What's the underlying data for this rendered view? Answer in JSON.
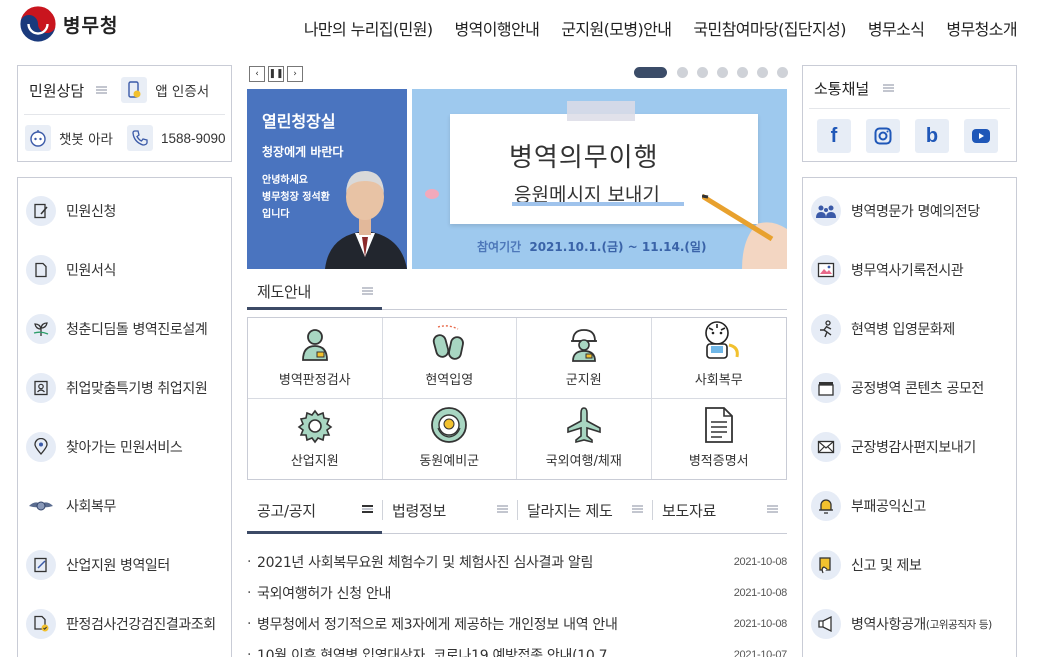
{
  "header": {
    "logo_text": "병무청",
    "nav": [
      "나만의 누리집(민원)",
      "병역이행안내",
      "군지원(모병)안내",
      "국민참여마당(집단지성)",
      "병무소식",
      "병무청소개"
    ]
  },
  "left_top": {
    "title": "민원상담",
    "app_auth": "앱 인증서",
    "chatbot": "챗봇 아라",
    "phone": "1588-9090"
  },
  "left_menu": [
    {
      "label": "민원신청",
      "icon": "pen-doc-icon"
    },
    {
      "label": "민원서식",
      "icon": "doc-icon"
    },
    {
      "label": "청춘디딤돌 병역진로설계",
      "icon": "sprout-icon"
    },
    {
      "label": "취업맞춤특기병 취업지원",
      "icon": "id-card-icon"
    },
    {
      "label": "찾아가는 민원서비스",
      "icon": "location-pin-icon"
    },
    {
      "label": "사회복무",
      "icon": "emblem-icon"
    },
    {
      "label": "산업지원 병역일터",
      "icon": "note-pen-icon"
    },
    {
      "label": "판정검사건강검진결과조회",
      "icon": "doc-check-icon"
    }
  ],
  "banner_left": {
    "title": "열린청장실",
    "line1": "청장에게 바란다",
    "line2": "안녕하세요",
    "line3": "병무청장 정석환",
    "line4": "입니다"
  },
  "banner_main": {
    "title": "병역의무이행",
    "subtitle": "응원메시지 보내기",
    "period_label": "참여기간",
    "period": "2021.10.1.(금) ~ 11.14.(일)"
  },
  "section1": {
    "tab": "제도안내"
  },
  "grid": [
    {
      "label": "병역판정검사",
      "icon": "person-card-icon"
    },
    {
      "label": "현역입영",
      "icon": "dog-tags-icon"
    },
    {
      "label": "군지원",
      "icon": "soldier-icon"
    },
    {
      "label": "사회복무",
      "icon": "tiger-mascot-icon"
    },
    {
      "label": "산업지원",
      "icon": "gear-icon"
    },
    {
      "label": "동원예비군",
      "icon": "reserve-emblem-icon"
    },
    {
      "label": "국외여행/체재",
      "icon": "airplane-icon"
    },
    {
      "label": "병적증명서",
      "icon": "document-icon"
    }
  ],
  "section2": {
    "tabs": [
      "공고/공지",
      "법령정보",
      "달라지는 제도",
      "보도자료"
    ]
  },
  "notices": [
    {
      "title": "2021년 사회복무요원 체험수기 및 체험사진 심사결과 알림",
      "date": "2021-10-08"
    },
    {
      "title": "국외여행허가 신청 안내",
      "date": "2021-10-08"
    },
    {
      "title": "병무청에서 정기적으로 제3자에게 제공하는 개인정보 내역 안내",
      "date": "2021-10-08"
    },
    {
      "title": "10월 이후 현역병 입영대상자, 코로나19 예방접종 안내(10.7.…",
      "date": "2021-10-07"
    }
  ],
  "right_top": {
    "title": "소통채널",
    "social": [
      "f",
      "ig",
      "b",
      "yt"
    ]
  },
  "right_menu": [
    {
      "label": "병역명문가 명예의전당",
      "icon": "family-icon"
    },
    {
      "label": "병무역사기록전시관",
      "icon": "picture-icon"
    },
    {
      "label": "현역병 입영문화제",
      "icon": "runner-icon"
    },
    {
      "label": "공정병역 콘텐츠 공모전",
      "icon": "clapper-icon"
    },
    {
      "label": "군장병감사편지보내기",
      "icon": "envelope-icon"
    },
    {
      "label": "부패공익신고",
      "icon": "bell-icon"
    },
    {
      "label": "신고 및 제보",
      "icon": "hand-doc-icon"
    },
    {
      "label": "병역사항공개",
      "sub": "(고위공직자 등)",
      "icon": "megaphone-icon"
    }
  ]
}
